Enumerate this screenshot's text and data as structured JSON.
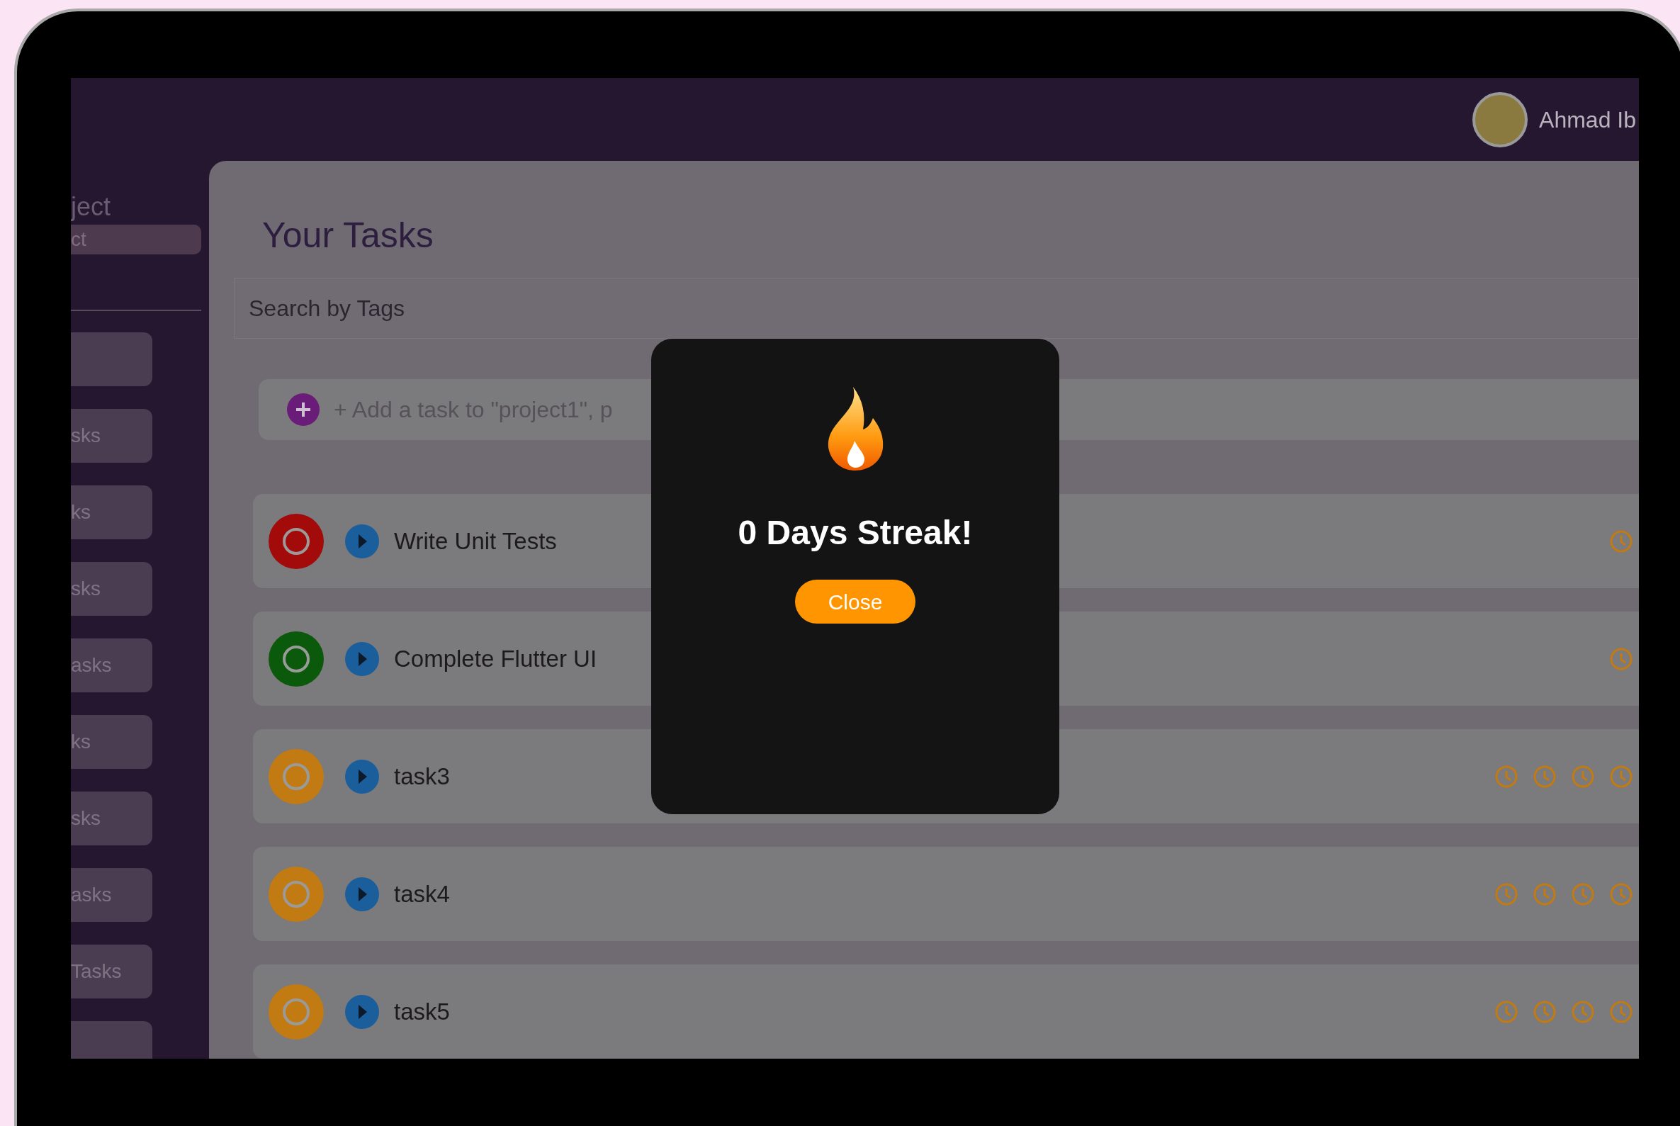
{
  "header": {
    "user_name": "Ahmad Ib"
  },
  "sidebar": {
    "title": "ject",
    "selected_project": "ct",
    "items": [
      {
        "kind": "blank"
      },
      {
        "kind": "text",
        "label": "sks"
      },
      {
        "kind": "text",
        "label": "ks"
      },
      {
        "kind": "text",
        "label": "sks"
      },
      {
        "kind": "text",
        "label": "asks"
      },
      {
        "kind": "text",
        "label": "ks"
      },
      {
        "kind": "text",
        "label": "sks"
      },
      {
        "kind": "text",
        "label": "asks"
      },
      {
        "kind": "text",
        "label": "Tasks"
      },
      {
        "kind": "blank"
      }
    ]
  },
  "main": {
    "heading": "Your Tasks",
    "search": {
      "placeholder": "Search by Tags"
    },
    "add_task": {
      "placeholder": "+ Add a task to \"project1\", p"
    },
    "tasks": [
      {
        "title": "Write Unit Tests",
        "color": "#a30a0a",
        "icons": [
          {
            "kind": "clock"
          }
        ]
      },
      {
        "title": "Complete Flutter UI",
        "color": "#0b5a0b",
        "icons": [
          {
            "kind": "clock"
          }
        ]
      },
      {
        "title": "task3",
        "color": "#c27b12",
        "icons": [
          {
            "kind": "clock"
          },
          {
            "kind": "clock"
          },
          {
            "kind": "clock"
          },
          {
            "kind": "clock"
          }
        ]
      },
      {
        "title": "task4",
        "color": "#c27b12",
        "icons": [
          {
            "kind": "clock"
          },
          {
            "kind": "clock"
          },
          {
            "kind": "clock"
          },
          {
            "kind": "clock"
          }
        ]
      },
      {
        "title": "task5",
        "color": "#c27b12",
        "icons": [
          {
            "kind": "clock"
          },
          {
            "kind": "clock"
          },
          {
            "kind": "clock"
          },
          {
            "kind": "clock"
          }
        ]
      }
    ]
  },
  "dialog": {
    "message": "0 Days Streak!",
    "button": "Close"
  }
}
